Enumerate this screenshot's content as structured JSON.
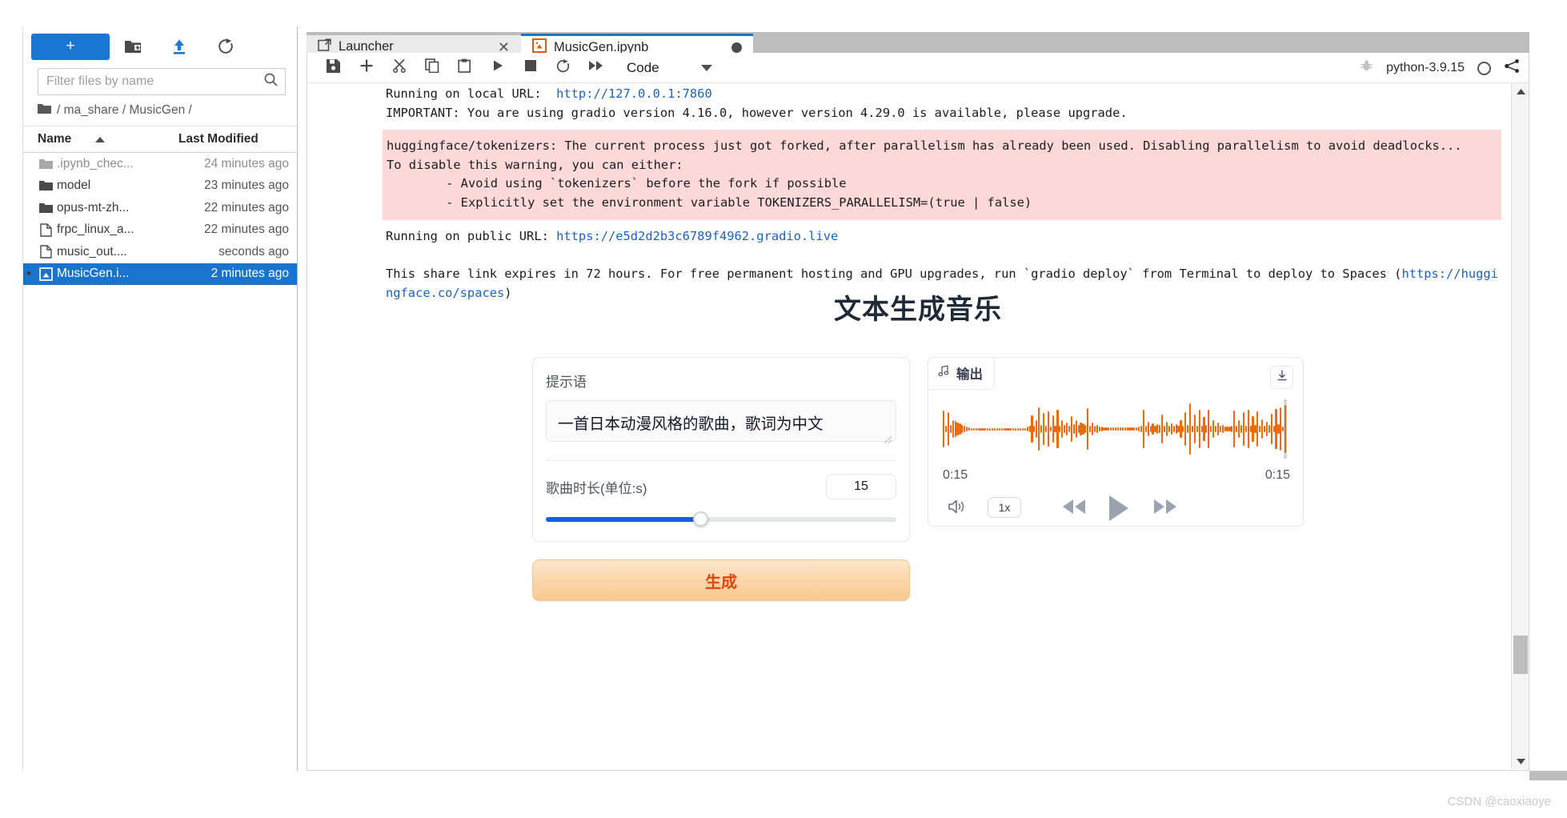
{
  "filebrowser": {
    "new_button_label": "+",
    "icons": {
      "new": "plus-icon",
      "new_folder": "new-folder-icon",
      "upload": "upload-icon",
      "refresh": "refresh-icon"
    },
    "filter_placeholder": "Filter files by name",
    "filter_value": "",
    "search_icon": "search-icon",
    "breadcrumbs": [
      "/",
      "ma_share",
      "/",
      "MusicGen",
      "/"
    ],
    "breadcrumb_text": "/ ma_share / MusicGen /",
    "columns": {
      "name": "Name",
      "modified": "Last Modified"
    },
    "sort": "ascending",
    "files": [
      {
        "name": ".ipynb_chec...",
        "modified": "24 minutes ago",
        "type": "folder",
        "dim": true,
        "selected": false
      },
      {
        "name": "model",
        "modified": "23 minutes ago",
        "type": "folder",
        "dim": false,
        "selected": false
      },
      {
        "name": "opus-mt-zh...",
        "modified": "22 minutes ago",
        "type": "folder",
        "dim": false,
        "selected": false
      },
      {
        "name": "frpc_linux_a...",
        "modified": "22 minutes ago",
        "type": "file",
        "dim": false,
        "selected": false
      },
      {
        "name": "music_out....",
        "modified": "seconds ago",
        "type": "file",
        "dim": false,
        "selected": false
      },
      {
        "name": "MusicGen.i...",
        "modified": "2 minutes ago",
        "type": "notebook",
        "dim": false,
        "selected": true
      }
    ]
  },
  "tabs": [
    {
      "label": "Launcher",
      "icon": "launcher-icon",
      "active": false,
      "closeable": true
    },
    {
      "label": "MusicGen.ipynb",
      "icon": "notebook-icon",
      "active": true,
      "dirty": true
    }
  ],
  "notebook_toolbar": {
    "buttons": [
      "save-icon",
      "insert-cell-icon",
      "cut-icon",
      "copy-icon",
      "paste-icon",
      "run-icon",
      "stop-icon",
      "restart-icon",
      "restart-run-all-icon"
    ],
    "cell_type": "Code",
    "debugger_icon": "bug-icon",
    "kernel_name": "python-3.9.15",
    "kernel_status": "idle",
    "share_icon": "share-icon"
  },
  "output": {
    "line_local": "Running on local URL:  ",
    "local_url": "http://127.0.0.1:7860",
    "line_important": "IMPORTANT: You are using gradio version 4.16.0, however version 4.29.0 is available, please upgrade.",
    "line_dashes": "--------",
    "warning": "huggingface/tokenizers: The current process just got forked, after parallelism has already been used. Disabling parallelism to avoid deadlocks...\nTo disable this warning, you can either:\n\t- Avoid using `tokenizers` before the fork if possible\n\t- Explicitly set the environment variable TOKENIZERS_PARALLELISM=(true | false)",
    "line_public": "Running on public URL: ",
    "public_url": "https://e5d2d2b3c6789f4962.gradio.live",
    "share_note_pre": "This share link expires in 72 hours. For free permanent hosting and GPU upgrades, run `gradio deploy` from Terminal to deploy to Spaces (",
    "share_note_url": "https://huggingface.co/spaces",
    "share_note_post": ")"
  },
  "gradio": {
    "title": "文本生成音乐",
    "prompt_label": "提示语",
    "prompt_value": "一首日本动漫风格的歌曲，歌词为中文",
    "duration_label": "歌曲时长(单位:s)",
    "duration_value": "15",
    "slider_percent": 44,
    "generate_label": "生成",
    "output_label": "输出",
    "output_icon": "music-note-icon",
    "download_icon": "download-icon",
    "time_current": "0:15",
    "time_total": "0:15",
    "speed_label": "1x",
    "volume_icon": "volume-icon",
    "rewind_icon": "rewind-icon",
    "play_icon": "play-icon",
    "forward_icon": "fast-forward-icon",
    "waveform": [
      62,
      10,
      56,
      14,
      30,
      26,
      22,
      18,
      14,
      12,
      8,
      5,
      4,
      4,
      4,
      4,
      4,
      4,
      4,
      4,
      4,
      4,
      4,
      4,
      4,
      4,
      4,
      4,
      4,
      4,
      4,
      4,
      4,
      4,
      4,
      4,
      8,
      12,
      46,
      10,
      30,
      74,
      14,
      54,
      10,
      60,
      8,
      46,
      12,
      64,
      10,
      30,
      14,
      22,
      10,
      42,
      16,
      30,
      14,
      22,
      18,
      14,
      70,
      12,
      22,
      10,
      14,
      8,
      8,
      6,
      5,
      5,
      5,
      5,
      5,
      5,
      5,
      5,
      5,
      5,
      5,
      5,
      5,
      6,
      8,
      10,
      66,
      12,
      24,
      10,
      18,
      12,
      16,
      14,
      48,
      10,
      24,
      12,
      18,
      10,
      16,
      12,
      30,
      10,
      58,
      14,
      86,
      10,
      48,
      12,
      66,
      10,
      40,
      14,
      64,
      12,
      30,
      10,
      22,
      10,
      14,
      8,
      8,
      8,
      10,
      62,
      12,
      30,
      14,
      58,
      10,
      66,
      12,
      44,
      14,
      60,
      10,
      32,
      12,
      24,
      14,
      52,
      10,
      68,
      16,
      74,
      8,
      82
    ],
    "waveform_color": "#f2690d"
  },
  "footer": {
    "watermark": "CSDN @caoxiaoye"
  }
}
